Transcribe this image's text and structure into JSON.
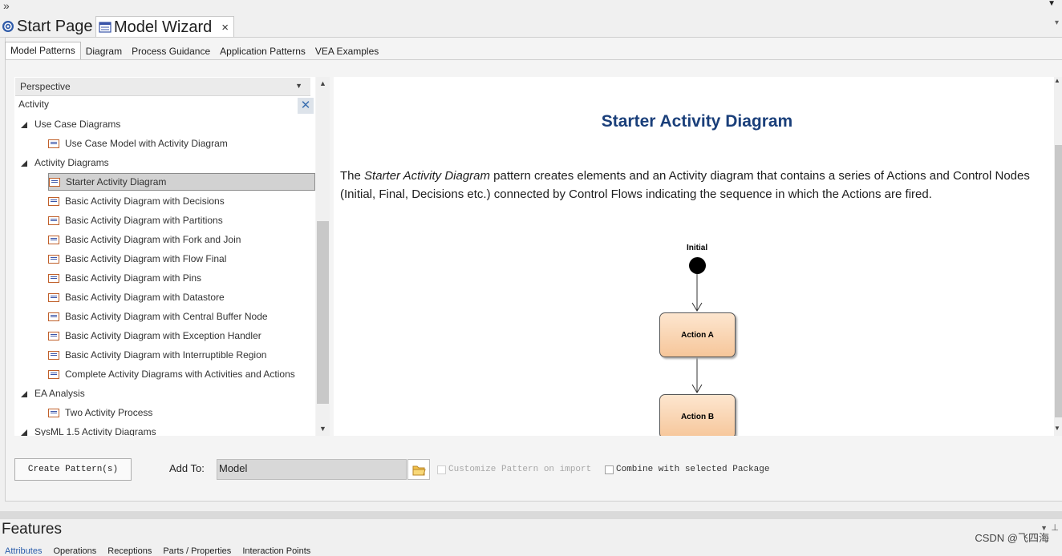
{
  "window": {
    "topbar_chevron": "»",
    "topbar_dropdown": "▼"
  },
  "doc_tabs": [
    {
      "label": "Start Page"
    },
    {
      "label": "Model Wizard",
      "close": "×"
    }
  ],
  "subtabs": [
    "Model Patterns",
    "Diagram",
    "Process Guidance",
    "Application Patterns",
    "VEA Examples"
  ],
  "perspective": {
    "label": "Perspective",
    "search_value": "Activity",
    "clear_icon": "✕"
  },
  "tree": [
    {
      "type": "group",
      "label": "Use Case Diagrams"
    },
    {
      "type": "item",
      "label": "Use Case Model with Activity Diagram"
    },
    {
      "type": "group",
      "label": "Activity Diagrams"
    },
    {
      "type": "item",
      "label": "Starter Activity Diagram",
      "selected": true
    },
    {
      "type": "item",
      "label": "Basic Activity Diagram with Decisions"
    },
    {
      "type": "item",
      "label": "Basic Activity Diagram with Partitions"
    },
    {
      "type": "item",
      "label": "Basic Activity Diagram with Fork and Join"
    },
    {
      "type": "item",
      "label": "Basic Activity Diagram with Flow Final"
    },
    {
      "type": "item",
      "label": "Basic Activity Diagram with Pins"
    },
    {
      "type": "item",
      "label": "Basic Activity Diagram with Datastore"
    },
    {
      "type": "item",
      "label": "Basic Activity Diagram with Central Buffer Node"
    },
    {
      "type": "item",
      "label": "Basic Activity Diagram with Exception Handler"
    },
    {
      "type": "item",
      "label": "Basic Activity Diagram with Interruptible Region"
    },
    {
      "type": "item",
      "label": "Complete Activity Diagrams with Activities and Actions"
    },
    {
      "type": "group",
      "label": "EA Analysis"
    },
    {
      "type": "item",
      "label": "Two Activity Process"
    },
    {
      "type": "group",
      "label": "SysML 1.5 Activity Diagrams"
    }
  ],
  "description": {
    "title": "Starter Activity Diagram",
    "text_pre": "The ",
    "text_em": "Starter Activity Diagram",
    "text_post": " pattern creates elements and an Activity diagram that contains a series of Actions and Control Nodes (Initial, Final, Decisions etc.) connected by Control Flows indicating the sequence in which the Actions are fired."
  },
  "diagram": {
    "initial_label": "Initial",
    "action_a": "Action A",
    "action_b": "Action B"
  },
  "bottom": {
    "create_button": "Create Pattern(s)",
    "add_to_label": "Add To:",
    "add_to_value": "Model",
    "customize_label": "Customize Pattern on import",
    "combine_label": "Combine with selected Package"
  },
  "features": {
    "title": "Features",
    "tabs": [
      "Attributes",
      "Operations",
      "Receptions",
      "Parts / Properties",
      "Interaction Points"
    ],
    "watermark": "CSDN @飞四海"
  },
  "colors": {
    "title_blue": "#1a3f7a",
    "action_fill": "#f6c69a",
    "selection": "#d2d2d2"
  }
}
